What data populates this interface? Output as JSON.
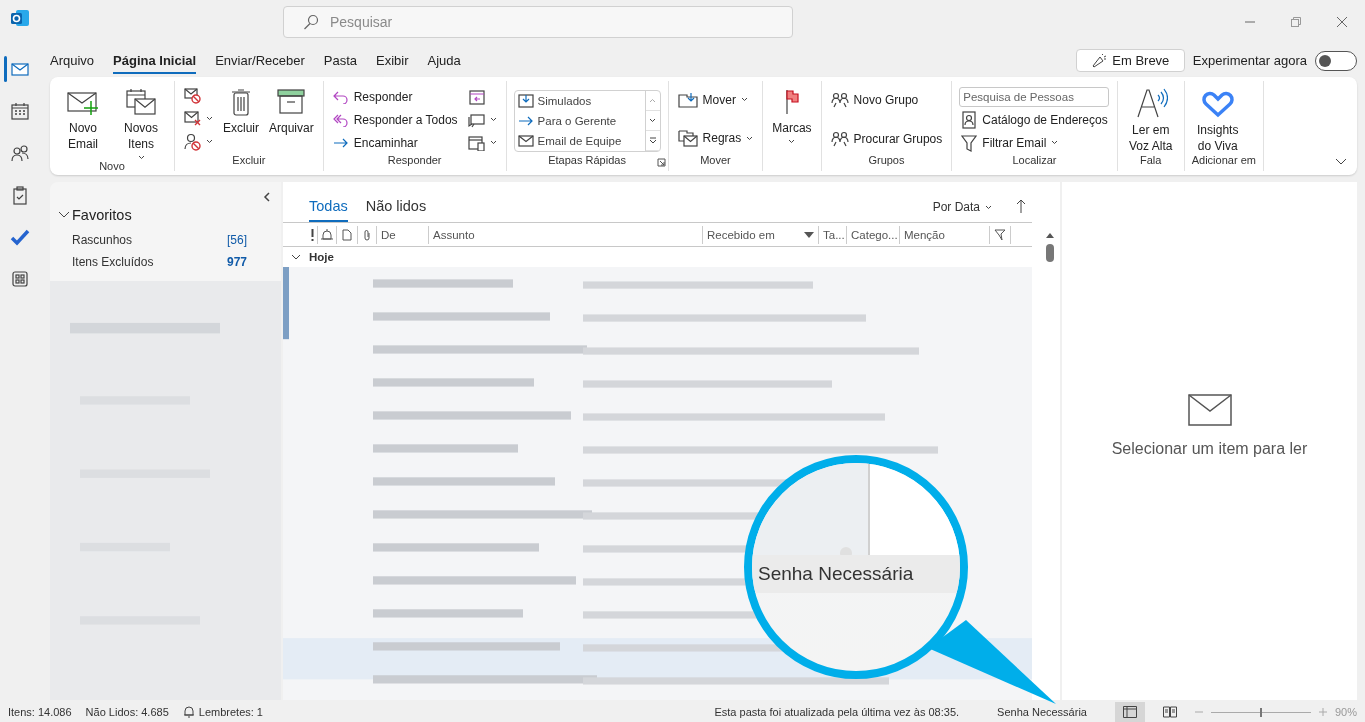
{
  "search": {
    "placeholder": "Pesquisar"
  },
  "nav_items": [
    {
      "kind": "mail",
      "selected": true
    },
    {
      "kind": "calendar",
      "selected": false
    },
    {
      "kind": "people",
      "selected": false
    },
    {
      "kind": "tasks",
      "selected": false
    },
    {
      "kind": "todo",
      "selected": false
    },
    {
      "kind": "apps",
      "selected": false
    }
  ],
  "menu_tabs": [
    {
      "label": "Arquivo",
      "selected": false
    },
    {
      "label": "Página Inicial",
      "selected": true
    },
    {
      "label": "Enviar/Receber",
      "selected": false
    },
    {
      "label": "Pasta",
      "selected": false
    },
    {
      "label": "Exibir",
      "selected": false
    },
    {
      "label": "Ajuda",
      "selected": false
    }
  ],
  "coming_soon_button": {
    "label": "Em Breve"
  },
  "try_now": {
    "label": "Experimentar agora",
    "on": false
  },
  "ribbon": {
    "groups": [
      {
        "label": "Novo",
        "columns": [
          [
            {
              "kind": "large",
              "label": "Novo Email",
              "dropdown": false
            }
          ],
          [
            {
              "kind": "large",
              "label": "Novos Itens",
              "dropdown": true
            }
          ]
        ]
      },
      {
        "label": "Excluir",
        "columns": [
          [
            {
              "kind": "icon",
              "dropdown": false
            },
            {
              "kind": "icon",
              "dropdown": true
            },
            {
              "kind": "icon",
              "dropdown": true
            }
          ],
          [
            {
              "kind": "large",
              "label": "Excluir",
              "dropdown": false
            }
          ],
          [
            {
              "kind": "large",
              "label": "Arquivar",
              "dropdown": false
            }
          ]
        ]
      },
      {
        "label": "Responder",
        "columns": [
          [
            {
              "kind": "small",
              "label": "Responder",
              "dropdown": false
            },
            {
              "kind": "small",
              "label": "Responder a Todos",
              "dropdown": false
            },
            {
              "kind": "small",
              "label": "Encaminhar",
              "dropdown": false
            }
          ],
          [
            {
              "kind": "icon",
              "dropdown": false
            },
            {
              "kind": "icon",
              "dropdown": true
            },
            {
              "kind": "icon",
              "dropdown": true
            }
          ]
        ]
      },
      {
        "label": "Etapas Rápidas",
        "launcher": true,
        "columns": [
          [
            {
              "kind": "gallery",
              "items": [
                "Simulados",
                "Para o Gerente",
                "Email de Equipe"
              ]
            }
          ]
        ]
      },
      {
        "label": "Mover",
        "columns": [
          [
            {
              "kind": "small",
              "label": "Mover",
              "dropdown": true
            },
            {
              "kind": "small",
              "label": "Regras",
              "dropdown": true
            }
          ]
        ]
      },
      {
        "columns": [
          [
            {
              "kind": "large",
              "label": "Marcas",
              "dropdown": true
            }
          ]
        ]
      },
      {
        "label": "Grupos",
        "columns": [
          [
            {
              "kind": "small",
              "label": "Novo Grupo",
              "dropdown": false
            },
            {
              "kind": "small",
              "label": "Procurar Grupos",
              "dropdown": false
            }
          ]
        ]
      },
      {
        "label": "Localizar",
        "columns": [
          [
            {
              "kind": "field",
              "placeholder": "Pesquisa de Pessoas"
            },
            {
              "kind": "small",
              "label": "Catálogo de Endereços",
              "dropdown": false
            },
            {
              "kind": "small",
              "label": "Filtrar Email",
              "dropdown": true
            }
          ]
        ]
      },
      {
        "label": "Fala",
        "columns": [
          [
            {
              "kind": "large",
              "label": "Ler em Voz Alta",
              "dropdown": false
            }
          ]
        ]
      },
      {
        "label": "Adicionar em",
        "columns": [
          [
            {
              "kind": "large",
              "label": "Insights do Viva",
              "dropdown": false
            }
          ]
        ]
      }
    ]
  },
  "folder_pane": {
    "favorites": {
      "label": "Favoritos",
      "expanded": true,
      "items": [
        {
          "label": "Rascunhos",
          "count": "[56]",
          "kind": "drafts"
        },
        {
          "label": "Itens Excluídos",
          "count": "977",
          "kind": "unread"
        }
      ]
    }
  },
  "message_list": {
    "view_tabs": [
      {
        "label": "Todas",
        "selected": true
      },
      {
        "label": "Não lidos",
        "selected": false
      }
    ],
    "sort": {
      "label": "Por Data"
    },
    "columns": [
      {
        "label": "De",
        "sorted": false
      },
      {
        "label": "Assunto",
        "sorted": false
      },
      {
        "label": "Recebido em",
        "sorted": true
      },
      {
        "label": "Ta...",
        "sorted": false
      },
      {
        "label": "Catego...",
        "sorted": false
      },
      {
        "label": "Menção",
        "sorted": false
      }
    ],
    "group": {
      "label": "Hoje",
      "expanded": true
    }
  },
  "reading_pane": {
    "message": "Selecionar um item para ler"
  },
  "callout": {
    "label": "Senha Necessária"
  },
  "status_bar": {
    "items": "Itens: 14.086",
    "unread": "Não Lidos: 4.685",
    "reminders": "Lembretes: 1",
    "updated": "Esta pasta foi atualizada pela última vez às 08:35.",
    "password": "Senha Necessária",
    "views": [
      {
        "kind": "normal",
        "selected": true
      },
      {
        "kind": "reading",
        "selected": false
      }
    ],
    "zoom": {
      "level": 0.5,
      "reading": "90%"
    }
  }
}
